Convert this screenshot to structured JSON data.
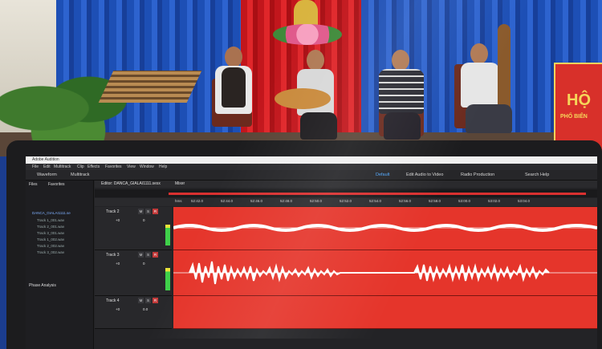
{
  "photo": {
    "banner_text_big": "HỘ",
    "banner_text_small": "PHỐ BIỂN"
  },
  "app": {
    "title": "Adobe Audition",
    "menu": [
      "File",
      "Edit",
      "Multitrack",
      "Clip",
      "Effects",
      "Favorites",
      "View",
      "Window",
      "Help"
    ],
    "toolbar_left": [
      "Waveform",
      "Multitrack"
    ],
    "workspaces": [
      "Default",
      "Edit Audio to Video",
      "Radio Production"
    ],
    "search_help": "Search Help",
    "accent_color": "#4fa8ff",
    "waveform_bg": "#e5352b"
  },
  "files_panel": {
    "tabs": [
      "Files",
      "Favorites"
    ],
    "items": [
      "DANCA_GIALAI1111.se",
      "Track 1_001.wav",
      "Track 2_001.wav",
      "Track 3_001.wav",
      "Track 1_002.wav",
      "Track 2_002.wav",
      "Track 3_002.wav"
    ],
    "phase_label": "Phase Analysis"
  },
  "editor": {
    "tab_label": "Editor: DANCA_GIALAI1111.sesx",
    "mixer_label": "Mixer",
    "time_units": "hms",
    "ruler": [
      "52:42.0",
      "52:44.0",
      "52:46.0",
      "52:48.0",
      "52:50.0",
      "52:52.0",
      "52:54.0",
      "52:56.0",
      "52:58.0",
      "53:00.0",
      "53:02.0",
      "53:04.0"
    ]
  },
  "tracks": [
    {
      "name": "Track 2",
      "m": "M",
      "s": "S",
      "r": "R",
      "vol": "+0",
      "pan": "0"
    },
    {
      "name": "Track 3",
      "m": "M",
      "s": "S",
      "r": "R",
      "vol": "+0",
      "pan": "0"
    },
    {
      "name": "Track 4",
      "m": "M",
      "s": "S",
      "r": "R",
      "vol": "+0",
      "pan": "0.0"
    }
  ]
}
